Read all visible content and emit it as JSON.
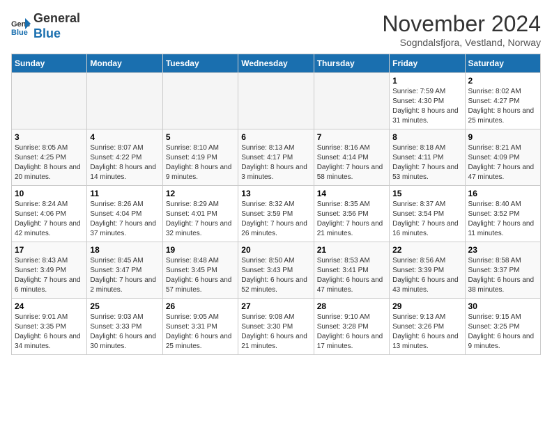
{
  "logo": {
    "general": "General",
    "blue": "Blue"
  },
  "header": {
    "title": "November 2024",
    "location": "Sogndalsfjora, Vestland, Norway"
  },
  "weekdays": [
    "Sunday",
    "Monday",
    "Tuesday",
    "Wednesday",
    "Thursday",
    "Friday",
    "Saturday"
  ],
  "weeks": [
    [
      {
        "day": "",
        "info": ""
      },
      {
        "day": "",
        "info": ""
      },
      {
        "day": "",
        "info": ""
      },
      {
        "day": "",
        "info": ""
      },
      {
        "day": "",
        "info": ""
      },
      {
        "day": "1",
        "info": "Sunrise: 7:59 AM\nSunset: 4:30 PM\nDaylight: 8 hours and 31 minutes."
      },
      {
        "day": "2",
        "info": "Sunrise: 8:02 AM\nSunset: 4:27 PM\nDaylight: 8 hours and 25 minutes."
      }
    ],
    [
      {
        "day": "3",
        "info": "Sunrise: 8:05 AM\nSunset: 4:25 PM\nDaylight: 8 hours and 20 minutes."
      },
      {
        "day": "4",
        "info": "Sunrise: 8:07 AM\nSunset: 4:22 PM\nDaylight: 8 hours and 14 minutes."
      },
      {
        "day": "5",
        "info": "Sunrise: 8:10 AM\nSunset: 4:19 PM\nDaylight: 8 hours and 9 minutes."
      },
      {
        "day": "6",
        "info": "Sunrise: 8:13 AM\nSunset: 4:17 PM\nDaylight: 8 hours and 3 minutes."
      },
      {
        "day": "7",
        "info": "Sunrise: 8:16 AM\nSunset: 4:14 PM\nDaylight: 7 hours and 58 minutes."
      },
      {
        "day": "8",
        "info": "Sunrise: 8:18 AM\nSunset: 4:11 PM\nDaylight: 7 hours and 53 minutes."
      },
      {
        "day": "9",
        "info": "Sunrise: 8:21 AM\nSunset: 4:09 PM\nDaylight: 7 hours and 47 minutes."
      }
    ],
    [
      {
        "day": "10",
        "info": "Sunrise: 8:24 AM\nSunset: 4:06 PM\nDaylight: 7 hours and 42 minutes."
      },
      {
        "day": "11",
        "info": "Sunrise: 8:26 AM\nSunset: 4:04 PM\nDaylight: 7 hours and 37 minutes."
      },
      {
        "day": "12",
        "info": "Sunrise: 8:29 AM\nSunset: 4:01 PM\nDaylight: 7 hours and 32 minutes."
      },
      {
        "day": "13",
        "info": "Sunrise: 8:32 AM\nSunset: 3:59 PM\nDaylight: 7 hours and 26 minutes."
      },
      {
        "day": "14",
        "info": "Sunrise: 8:35 AM\nSunset: 3:56 PM\nDaylight: 7 hours and 21 minutes."
      },
      {
        "day": "15",
        "info": "Sunrise: 8:37 AM\nSunset: 3:54 PM\nDaylight: 7 hours and 16 minutes."
      },
      {
        "day": "16",
        "info": "Sunrise: 8:40 AM\nSunset: 3:52 PM\nDaylight: 7 hours and 11 minutes."
      }
    ],
    [
      {
        "day": "17",
        "info": "Sunrise: 8:43 AM\nSunset: 3:49 PM\nDaylight: 7 hours and 6 minutes."
      },
      {
        "day": "18",
        "info": "Sunrise: 8:45 AM\nSunset: 3:47 PM\nDaylight: 7 hours and 2 minutes."
      },
      {
        "day": "19",
        "info": "Sunrise: 8:48 AM\nSunset: 3:45 PM\nDaylight: 6 hours and 57 minutes."
      },
      {
        "day": "20",
        "info": "Sunrise: 8:50 AM\nSunset: 3:43 PM\nDaylight: 6 hours and 52 minutes."
      },
      {
        "day": "21",
        "info": "Sunrise: 8:53 AM\nSunset: 3:41 PM\nDaylight: 6 hours and 47 minutes."
      },
      {
        "day": "22",
        "info": "Sunrise: 8:56 AM\nSunset: 3:39 PM\nDaylight: 6 hours and 43 minutes."
      },
      {
        "day": "23",
        "info": "Sunrise: 8:58 AM\nSunset: 3:37 PM\nDaylight: 6 hours and 38 minutes."
      }
    ],
    [
      {
        "day": "24",
        "info": "Sunrise: 9:01 AM\nSunset: 3:35 PM\nDaylight: 6 hours and 34 minutes."
      },
      {
        "day": "25",
        "info": "Sunrise: 9:03 AM\nSunset: 3:33 PM\nDaylight: 6 hours and 30 minutes."
      },
      {
        "day": "26",
        "info": "Sunrise: 9:05 AM\nSunset: 3:31 PM\nDaylight: 6 hours and 25 minutes."
      },
      {
        "day": "27",
        "info": "Sunrise: 9:08 AM\nSunset: 3:30 PM\nDaylight: 6 hours and 21 minutes."
      },
      {
        "day": "28",
        "info": "Sunrise: 9:10 AM\nSunset: 3:28 PM\nDaylight: 6 hours and 17 minutes."
      },
      {
        "day": "29",
        "info": "Sunrise: 9:13 AM\nSunset: 3:26 PM\nDaylight: 6 hours and 13 minutes."
      },
      {
        "day": "30",
        "info": "Sunrise: 9:15 AM\nSunset: 3:25 PM\nDaylight: 6 hours and 9 minutes."
      }
    ]
  ]
}
